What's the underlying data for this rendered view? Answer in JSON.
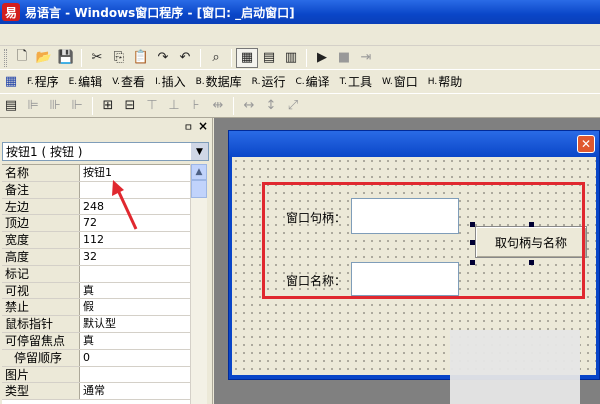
{
  "window": {
    "title": "易语言 - Windows窗口程序 - [窗口: _启动窗口]",
    "app_icon_label": "易"
  },
  "toolbar1": {
    "icons": [
      "page-icon",
      "open-icon",
      "save-icon",
      "cut-icon",
      "copy-icon",
      "paste-icon",
      "redo-icon",
      "undo-icon",
      "find-icon",
      "layout1-icon",
      "layout2-icon",
      "layout3-icon",
      "run-icon",
      "stop-icon",
      "step-icon"
    ]
  },
  "menu": {
    "items": [
      {
        "key": "F.",
        "label": "程序"
      },
      {
        "key": "E.",
        "label": "编辑"
      },
      {
        "key": "V.",
        "label": "查看"
      },
      {
        "key": "I.",
        "label": "插入"
      },
      {
        "key": "B.",
        "label": "数据库"
      },
      {
        "key": "R.",
        "label": "运行"
      },
      {
        "key": "C.",
        "label": "编译"
      },
      {
        "key": "T.",
        "label": "工具"
      },
      {
        "key": "W.",
        "label": "窗口"
      },
      {
        "key": "H.",
        "label": "帮助"
      }
    ]
  },
  "panel": {
    "pin": "ㅁ",
    "close": "×",
    "selector": "按钮1 ( 按钮 )",
    "properties": [
      {
        "name": "名称",
        "value": "按钮1"
      },
      {
        "name": "备注",
        "value": ""
      },
      {
        "name": "左边",
        "value": "248"
      },
      {
        "name": "顶边",
        "value": "72"
      },
      {
        "name": "宽度",
        "value": "112"
      },
      {
        "name": "高度",
        "value": "32"
      },
      {
        "name": "标记",
        "value": ""
      },
      {
        "name": "可视",
        "value": "真"
      },
      {
        "name": "禁止",
        "value": "假"
      },
      {
        "name": "鼠标指针",
        "value": "默认型"
      },
      {
        "name": "可停留焦点",
        "value": "真"
      },
      {
        "name": "停留顺序",
        "value": "0"
      },
      {
        "name": "图片",
        "value": ""
      },
      {
        "name": "类型",
        "value": "通常"
      }
    ]
  },
  "designer": {
    "close": "✕",
    "label_handle": "窗口句柄：",
    "label_name": "窗口名称：",
    "button_label": "取句柄与名称"
  },
  "colors": {
    "accent_red": "#e0282f",
    "title_blue": "#0a46c8"
  }
}
